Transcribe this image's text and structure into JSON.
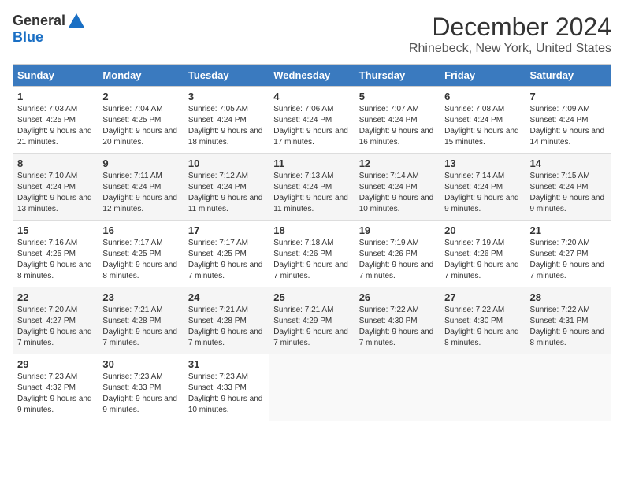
{
  "header": {
    "logo_general": "General",
    "logo_blue": "Blue",
    "title": "December 2024",
    "subtitle": "Rhinebeck, New York, United States"
  },
  "calendar": {
    "days_of_week": [
      "Sunday",
      "Monday",
      "Tuesday",
      "Wednesday",
      "Thursday",
      "Friday",
      "Saturday"
    ],
    "weeks": [
      [
        {
          "day": "1",
          "sunrise": "7:03 AM",
          "sunset": "4:25 PM",
          "daylight": "9 hours and 21 minutes."
        },
        {
          "day": "2",
          "sunrise": "7:04 AM",
          "sunset": "4:25 PM",
          "daylight": "9 hours and 20 minutes."
        },
        {
          "day": "3",
          "sunrise": "7:05 AM",
          "sunset": "4:24 PM",
          "daylight": "9 hours and 18 minutes."
        },
        {
          "day": "4",
          "sunrise": "7:06 AM",
          "sunset": "4:24 PM",
          "daylight": "9 hours and 17 minutes."
        },
        {
          "day": "5",
          "sunrise": "7:07 AM",
          "sunset": "4:24 PM",
          "daylight": "9 hours and 16 minutes."
        },
        {
          "day": "6",
          "sunrise": "7:08 AM",
          "sunset": "4:24 PM",
          "daylight": "9 hours and 15 minutes."
        },
        {
          "day": "7",
          "sunrise": "7:09 AM",
          "sunset": "4:24 PM",
          "daylight": "9 hours and 14 minutes."
        }
      ],
      [
        {
          "day": "8",
          "sunrise": "7:10 AM",
          "sunset": "4:24 PM",
          "daylight": "9 hours and 13 minutes."
        },
        {
          "day": "9",
          "sunrise": "7:11 AM",
          "sunset": "4:24 PM",
          "daylight": "9 hours and 12 minutes."
        },
        {
          "day": "10",
          "sunrise": "7:12 AM",
          "sunset": "4:24 PM",
          "daylight": "9 hours and 11 minutes."
        },
        {
          "day": "11",
          "sunrise": "7:13 AM",
          "sunset": "4:24 PM",
          "daylight": "9 hours and 11 minutes."
        },
        {
          "day": "12",
          "sunrise": "7:14 AM",
          "sunset": "4:24 PM",
          "daylight": "9 hours and 10 minutes."
        },
        {
          "day": "13",
          "sunrise": "7:14 AM",
          "sunset": "4:24 PM",
          "daylight": "9 hours and 9 minutes."
        },
        {
          "day": "14",
          "sunrise": "7:15 AM",
          "sunset": "4:24 PM",
          "daylight": "9 hours and 9 minutes."
        }
      ],
      [
        {
          "day": "15",
          "sunrise": "7:16 AM",
          "sunset": "4:25 PM",
          "daylight": "9 hours and 8 minutes."
        },
        {
          "day": "16",
          "sunrise": "7:17 AM",
          "sunset": "4:25 PM",
          "daylight": "9 hours and 8 minutes."
        },
        {
          "day": "17",
          "sunrise": "7:17 AM",
          "sunset": "4:25 PM",
          "daylight": "9 hours and 7 minutes."
        },
        {
          "day": "18",
          "sunrise": "7:18 AM",
          "sunset": "4:26 PM",
          "daylight": "9 hours and 7 minutes."
        },
        {
          "day": "19",
          "sunrise": "7:19 AM",
          "sunset": "4:26 PM",
          "daylight": "9 hours and 7 minutes."
        },
        {
          "day": "20",
          "sunrise": "7:19 AM",
          "sunset": "4:26 PM",
          "daylight": "9 hours and 7 minutes."
        },
        {
          "day": "21",
          "sunrise": "7:20 AM",
          "sunset": "4:27 PM",
          "daylight": "9 hours and 7 minutes."
        }
      ],
      [
        {
          "day": "22",
          "sunrise": "7:20 AM",
          "sunset": "4:27 PM",
          "daylight": "9 hours and 7 minutes."
        },
        {
          "day": "23",
          "sunrise": "7:21 AM",
          "sunset": "4:28 PM",
          "daylight": "9 hours and 7 minutes."
        },
        {
          "day": "24",
          "sunrise": "7:21 AM",
          "sunset": "4:28 PM",
          "daylight": "9 hours and 7 minutes."
        },
        {
          "day": "25",
          "sunrise": "7:21 AM",
          "sunset": "4:29 PM",
          "daylight": "9 hours and 7 minutes."
        },
        {
          "day": "26",
          "sunrise": "7:22 AM",
          "sunset": "4:30 PM",
          "daylight": "9 hours and 7 minutes."
        },
        {
          "day": "27",
          "sunrise": "7:22 AM",
          "sunset": "4:30 PM",
          "daylight": "9 hours and 8 minutes."
        },
        {
          "day": "28",
          "sunrise": "7:22 AM",
          "sunset": "4:31 PM",
          "daylight": "9 hours and 8 minutes."
        }
      ],
      [
        {
          "day": "29",
          "sunrise": "7:23 AM",
          "sunset": "4:32 PM",
          "daylight": "9 hours and 9 minutes."
        },
        {
          "day": "30",
          "sunrise": "7:23 AM",
          "sunset": "4:33 PM",
          "daylight": "9 hours and 9 minutes."
        },
        {
          "day": "31",
          "sunrise": "7:23 AM",
          "sunset": "4:33 PM",
          "daylight": "9 hours and 10 minutes."
        },
        null,
        null,
        null,
        null
      ]
    ]
  }
}
